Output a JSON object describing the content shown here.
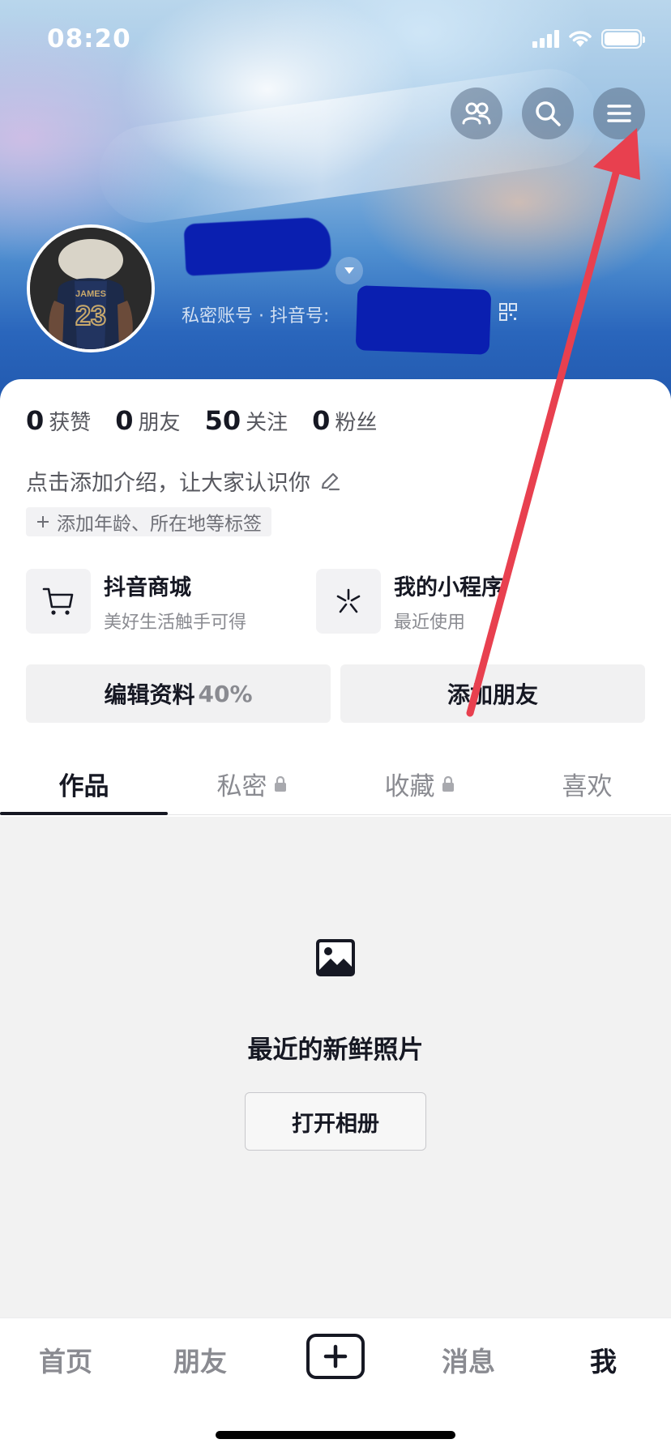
{
  "status_bar": {
    "time": "08:20"
  },
  "profile": {
    "account_prefix": "私密账号 · 抖音号: "
  },
  "stats": [
    {
      "value": "0",
      "label": "获赞"
    },
    {
      "value": "0",
      "label": "朋友"
    },
    {
      "value": "50",
      "label": "关注"
    },
    {
      "value": "0",
      "label": "粉丝"
    }
  ],
  "bio": {
    "placeholder": "点击添加介绍，让大家认识你"
  },
  "tag_chip": {
    "label": "添加年龄、所在地等标签"
  },
  "shortcuts": [
    {
      "title": "抖音商城",
      "subtitle": "美好生活触手可得",
      "icon": "cart-icon"
    },
    {
      "title": "我的小程序",
      "subtitle": "最近使用",
      "icon": "mini-program-icon"
    }
  ],
  "actions": {
    "edit_label": "编辑资料",
    "edit_progress": "40%",
    "add_friend_label": "添加朋友"
  },
  "tabs": [
    {
      "label": "作品",
      "active": true,
      "locked": false
    },
    {
      "label": "私密",
      "active": false,
      "locked": true
    },
    {
      "label": "收藏",
      "active": false,
      "locked": true
    },
    {
      "label": "喜欢",
      "active": false,
      "locked": false
    }
  ],
  "empty_state": {
    "title": "最近的新鲜照片",
    "button": "打开相册",
    "icon": "image-icon"
  },
  "bottom_nav": [
    {
      "label": "首页",
      "active": false
    },
    {
      "label": "朋友",
      "active": false
    },
    {
      "label": "消息",
      "active": false
    },
    {
      "label": "我",
      "active": true
    }
  ],
  "colors": {
    "accent_text": "#161823",
    "annotation_arrow": "#e8404f",
    "redaction": "#0a1fb0"
  }
}
